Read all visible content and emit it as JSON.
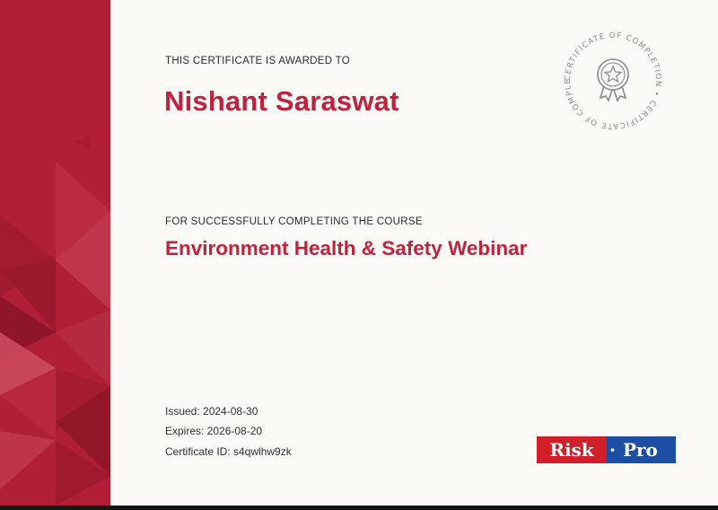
{
  "certificate": {
    "awarded_label": "THIS CERTIFICATE IS AWARDED TO",
    "recipient_name": "Nishant Saraswat",
    "course_label": "FOR SUCCESSFULLY COMPLETING THE COURSE",
    "course_name": "Environment Health & Safety Webinar",
    "issued": "Issued: 2024-08-30",
    "expires": "Expires: 2026-08-20",
    "certificate_id": "Certificate ID: s4qwlhw9zk"
  },
  "seal": {
    "ring_text": "CERTIFICATE OF COMPLETION • CERTIFICATE OF COMPLETION •",
    "icon": "award-star-icon"
  },
  "logo": {
    "part1": "Risk",
    "separator": "·",
    "part2": "Pro"
  },
  "colors": {
    "accent": "#c0223d",
    "band": "#b11f36",
    "background": "#fbfaf6",
    "logo_red": "#d2202b",
    "logo_blue": "#1c4fa3"
  }
}
